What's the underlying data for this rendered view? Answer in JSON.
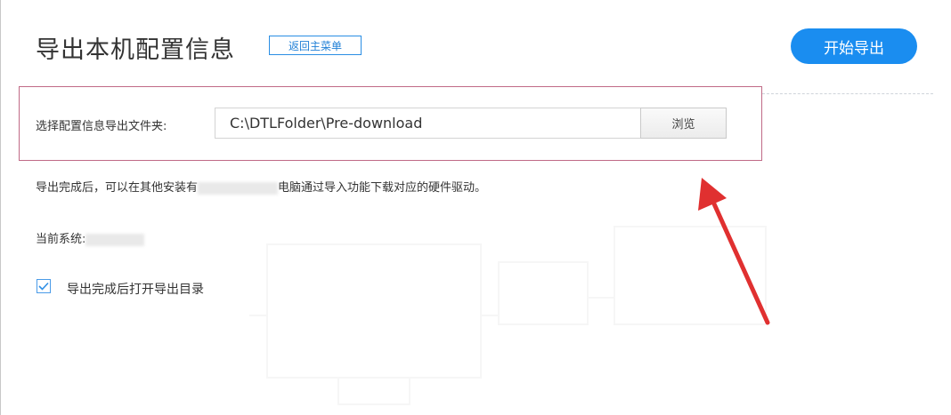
{
  "header": {
    "title": "导出本机配置信息",
    "back_label": "返回主菜单",
    "start_label": "开始导出"
  },
  "folder": {
    "label": "选择配置信息导出文件夹:",
    "path": "C:\\DTLFolder\\Pre-download",
    "browse_label": "浏览"
  },
  "info": {
    "text_before": "导出完成后，可以在其他安装有",
    "text_after": "电脑通过导入功能下载对应的硬件驱动。"
  },
  "system": {
    "label": "当前系统:"
  },
  "option": {
    "label": "导出完成后打开导出目录",
    "checked": true
  },
  "colors": {
    "accent": "#1a8df0",
    "highlight_border": "#c06a86",
    "annotation_arrow": "#e03030"
  },
  "icons": {
    "checkbox": "checkmark-icon",
    "annotation": "red-arrow-icon"
  }
}
